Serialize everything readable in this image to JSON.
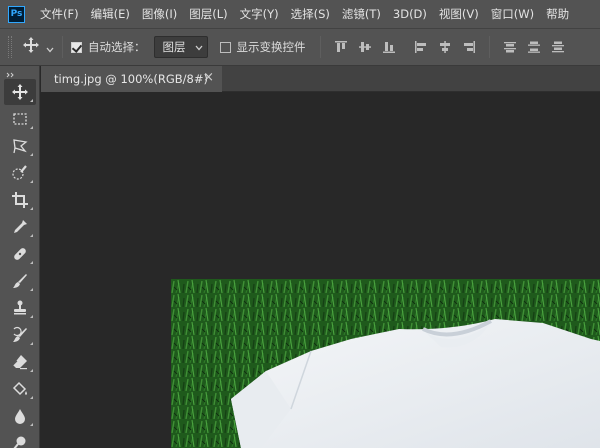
{
  "app": {
    "logo_text": "Ps",
    "accent": "#31a8ff"
  },
  "menu": {
    "items": [
      "文件(F)",
      "编辑(E)",
      "图像(I)",
      "图层(L)",
      "文字(Y)",
      "选择(S)",
      "滤镜(T)",
      "3D(D)",
      "视图(V)",
      "窗口(W)",
      "帮助"
    ]
  },
  "options": {
    "auto_select_label": "自动选择：",
    "auto_select_checked": true,
    "auto_select_target": "图层",
    "show_transform_label": "显示变换控件",
    "show_transform_checked": false
  },
  "document": {
    "tab_title": "timg.jpg @ 100%(RGB/8#)",
    "close_glyph": "×"
  },
  "tools": [
    "move-tool",
    "marquee-tool",
    "lasso-tool",
    "quick-select-tool",
    "crop-tool",
    "eyedropper-tool",
    "healing-brush-tool",
    "brush-tool",
    "clone-stamp-tool",
    "history-brush-tool",
    "eraser-tool",
    "paint-bucket-tool",
    "blur-tool",
    "dodge-tool"
  ],
  "canvas": {
    "background": "#282828",
    "image_subject": "white t-shirt on grass"
  }
}
